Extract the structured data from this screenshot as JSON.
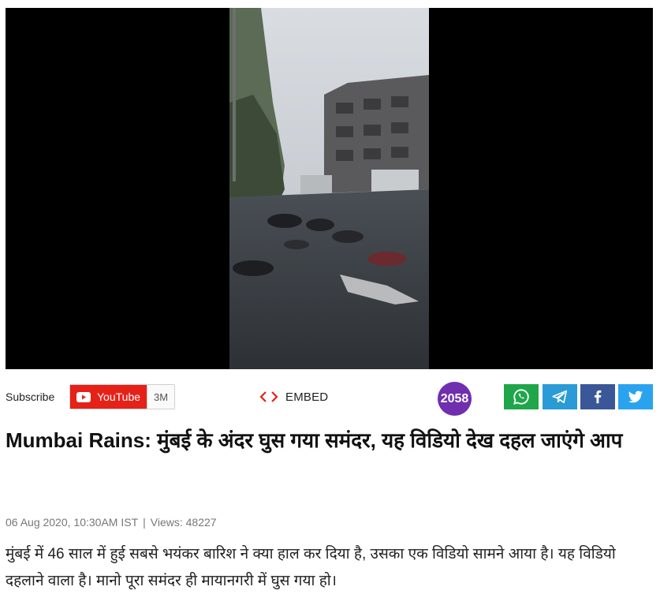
{
  "video": {
    "player_icon": "video-player"
  },
  "toolbar": {
    "subscribe_label": "Subscribe",
    "youtube_label": "YouTube",
    "youtube_count": "3M",
    "embed_label": "EMBED",
    "share_count": "2058"
  },
  "share": {
    "whatsapp_icon": "whatsapp-icon",
    "telegram_icon": "telegram-icon",
    "facebook_icon": "facebook-icon",
    "twitter_icon": "twitter-icon"
  },
  "article": {
    "headline": "Mumbai Rains: मुंबई के अंदर घुस गया समंदर, यह विडियो देख दहल जाएंगे आप",
    "date": "06 Aug 2020, 10:30AM IST",
    "separator": "|",
    "views": "Views: 48227",
    "lede": "मुंबई में 46 साल में हुई सबसे भयंकर बारिश ने क्या हाल कर दिया है, उसका एक विडियो सामने आया है। यह विडियो दहलाने वाला है। मानो पूरा समंदर ही मायानगरी में घुस गया हो।"
  },
  "colors": {
    "youtube": "#e62117",
    "share_badge": "#6f2fae",
    "whatsapp": "#1fa64b",
    "telegram": "#2a9bd6",
    "facebook": "#3a5797",
    "twitter": "#2aa3ef"
  }
}
